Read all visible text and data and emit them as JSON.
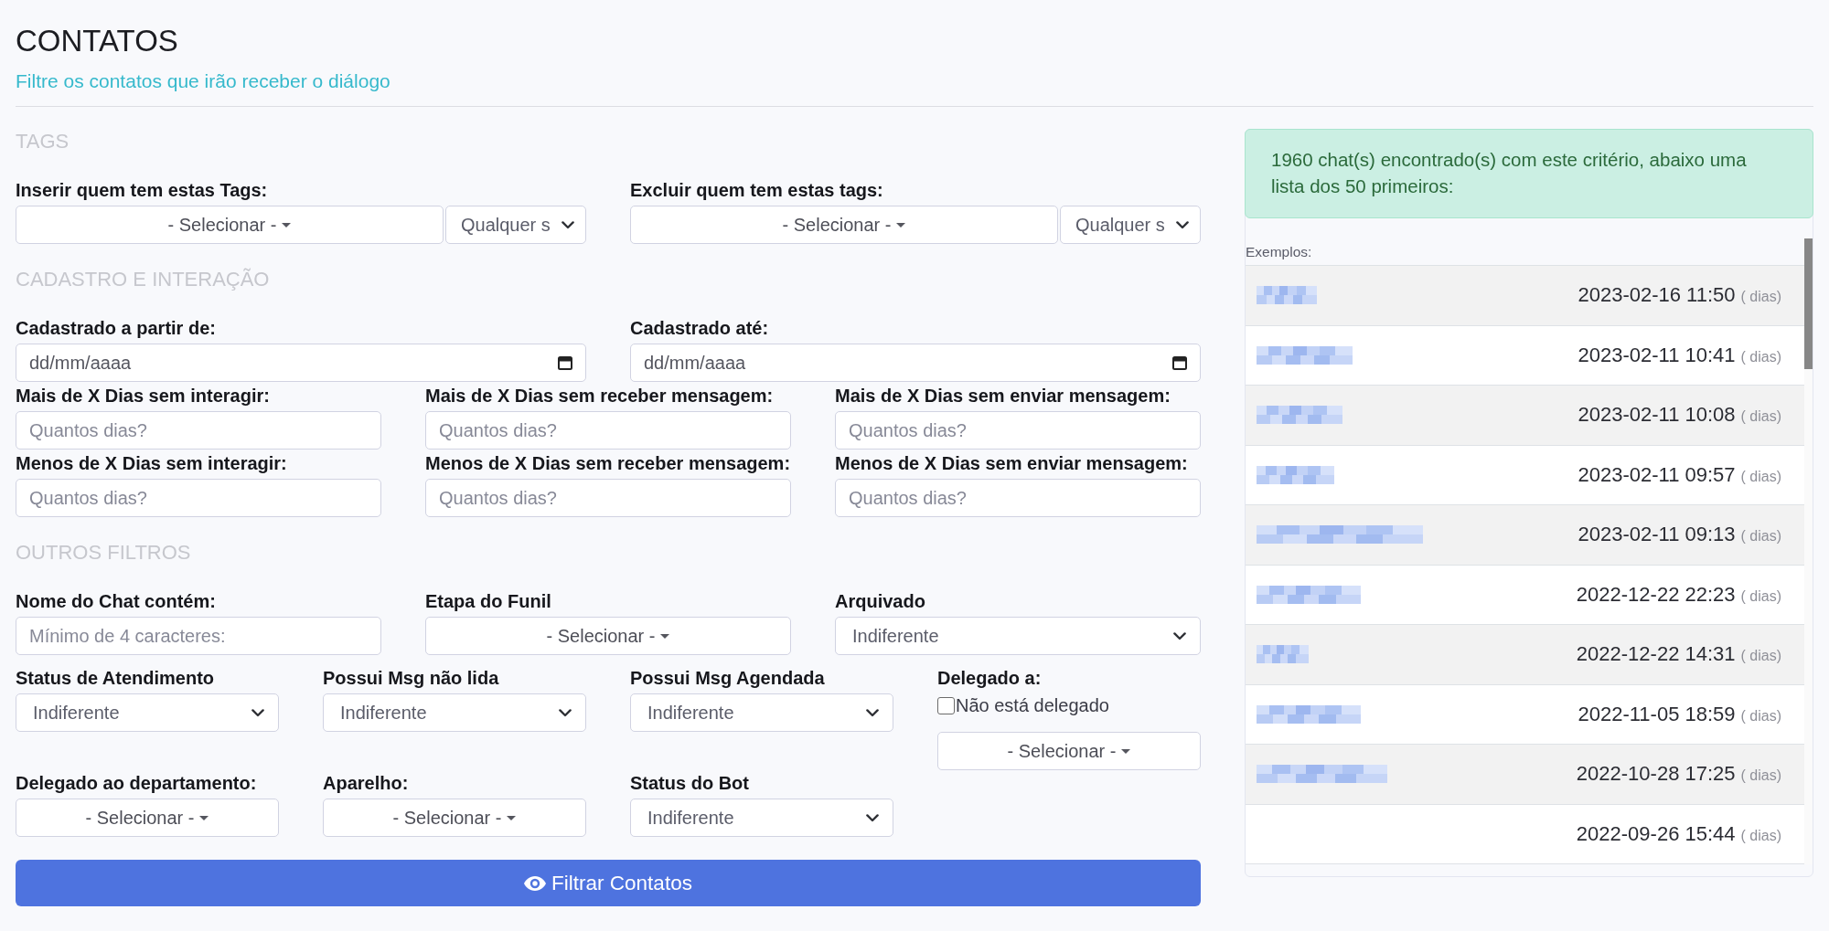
{
  "header": {
    "title": "CONTATOS",
    "subtitle": "Filtre os contatos que irão receber o diálogo"
  },
  "sections": [
    {
      "title": "TAGS",
      "rows": [
        [
          {
            "kind": "tag_select",
            "label": "Inserir quem tem estas Tags:",
            "button": "- Selecionar -",
            "value": "Qualquer s"
          },
          {
            "kind": "tag_select",
            "label": "Excluir quem tem estas tags:",
            "button": "- Selecionar -",
            "value": "Qualquer s"
          }
        ]
      ]
    },
    {
      "title": "CADASTRO E INTERAÇÃO",
      "rows": [
        [
          {
            "kind": "date",
            "label": "Cadastrado a partir de:",
            "placeholder": "dd/mm/aaaa"
          },
          {
            "kind": "date",
            "label": "Cadastrado até:",
            "placeholder": "dd/mm/aaaa"
          }
        ],
        [
          {
            "kind": "number",
            "label": "Mais de X Dias sem interagir:",
            "placeholder": "Quantos dias?"
          },
          {
            "kind": "number",
            "label": "Mais de X Dias sem receber mensagem:",
            "placeholder": "Quantos dias?"
          },
          {
            "kind": "number",
            "label": "Mais de X Dias sem enviar mensagem:",
            "placeholder": "Quantos dias?"
          }
        ],
        [
          {
            "kind": "number",
            "label": "Menos de X Dias sem interagir:",
            "placeholder": "Quantos dias?"
          },
          {
            "kind": "number",
            "label": "Menos de X Dias sem receber mensagem:",
            "placeholder": "Quantos dias?"
          },
          {
            "kind": "number",
            "label": "Menos de X Dias sem enviar mensagem:",
            "placeholder": "Quantos dias?"
          }
        ]
      ]
    },
    {
      "title": "OUTROS FILTROS",
      "rows": [
        [
          {
            "kind": "text",
            "label": "Nome do Chat contém:",
            "placeholder": "Mínimo de 4 caracteres:"
          },
          {
            "kind": "dropdown",
            "label": "Etapa do Funil",
            "button": "- Selecionar -"
          },
          {
            "kind": "select",
            "label": "Arquivado",
            "value": "Indiferente"
          }
        ],
        [
          {
            "kind": "select",
            "label": "Status de Atendimento",
            "value": "Indiferente"
          },
          {
            "kind": "select",
            "label": "Possui Msg não lida",
            "value": "Indiferente"
          },
          {
            "kind": "select",
            "label": "Possui Msg Agendada",
            "value": "Indiferente"
          },
          {
            "kind": "delegate",
            "label": "Delegado a:",
            "checkbox": {
              "label": "Não está delegado",
              "checked": false
            },
            "button": "- Selecionar -"
          }
        ],
        [
          {
            "kind": "dropdown",
            "label": "Delegado ao departamento:",
            "button": "- Selecionar -"
          },
          {
            "kind": "dropdown",
            "label": "Aparelho:",
            "button": "- Selecionar -"
          },
          {
            "kind": "select",
            "label": "Status do Bot",
            "value": "Indiferente"
          }
        ]
      ]
    }
  ],
  "filter_button": {
    "label": "Filtrar Contatos"
  },
  "results": {
    "message": "1960 chat(s) encontrado(s) com este critério, abaixo uma lista dos 50 primeiros:",
    "examples_label": "Exemplos:",
    "rows": [
      {
        "blurred_name": true,
        "date": "2023-02-16 11:50",
        "days": "( dias)"
      },
      {
        "blurred_name": true,
        "date": "2023-02-11 10:41",
        "days": "( dias)"
      },
      {
        "blurred_name": true,
        "date": "2023-02-11 10:08",
        "days": "( dias)"
      },
      {
        "blurred_name": true,
        "date": "2023-02-11 09:57",
        "days": "( dias)"
      },
      {
        "blurred_name": true,
        "date": "2023-02-11 09:13",
        "days": "( dias)"
      },
      {
        "blurred_name": true,
        "date": "2022-12-22 22:23",
        "days": "( dias)"
      },
      {
        "blurred_name": true,
        "date": "2022-12-22 14:31",
        "days": "( dias)"
      },
      {
        "blurred_name": true,
        "date": "2022-11-05 18:59",
        "days": "( dias)"
      },
      {
        "blurred_name": true,
        "date": "2022-10-28 17:25",
        "days": "( dias)"
      },
      {
        "blurred_name": false,
        "date": "2022-09-26 15:44",
        "days": "( dias)"
      }
    ]
  }
}
